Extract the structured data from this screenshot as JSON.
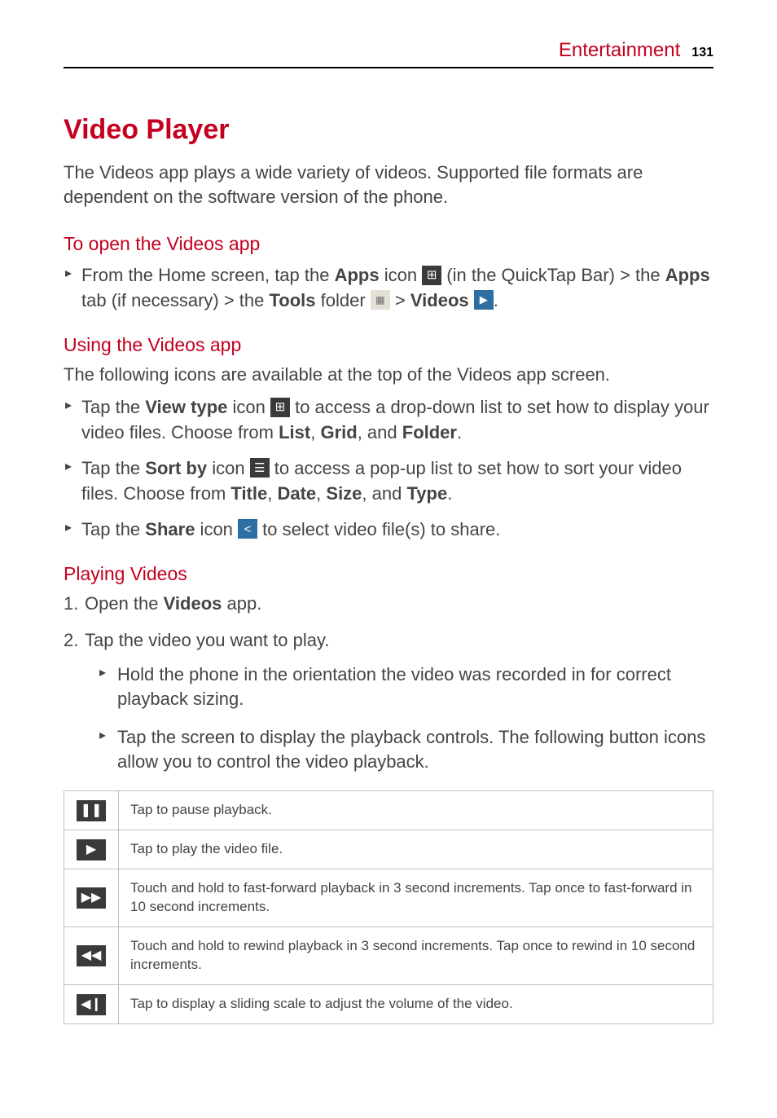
{
  "header": {
    "section": "Entertainment",
    "page_number": "131"
  },
  "title": "Video Player",
  "intro": "The Videos app plays a wide variety of videos. Supported file formats are dependent on the software version of the phone.",
  "open_app": {
    "heading": "To open the Videos app",
    "text_parts": {
      "p1": "From the Home screen, tap the ",
      "apps_label": "Apps",
      "p2": " icon ",
      "p3": " (in the QuickTap Bar) > the ",
      "apps_tab_label": "Apps",
      "p4": " tab (if necessary) > the ",
      "tools_label": "Tools",
      "p5": " folder ",
      "p6": " > ",
      "videos_label": "Videos",
      "p7": " ",
      "p8": "."
    }
  },
  "using_app": {
    "heading": "Using the Videos app",
    "intro": "The following icons are available at the top of the Videos app screen.",
    "items": {
      "view_type": {
        "p1": "Tap the ",
        "label": "View type",
        "p2": " icon ",
        "p3": " to access a drop-down list to set how to display your video files. Choose from ",
        "opt1": "List",
        "sep1": ", ",
        "opt2": "Grid",
        "sep2": ", and ",
        "opt3": "Folder",
        "end": "."
      },
      "sort_by": {
        "p1": "Tap the ",
        "label": "Sort by",
        "p2": " icon ",
        "p3": " to access a pop-up list to set how to sort your video files. Choose from ",
        "opt1": "Title",
        "sep1": ", ",
        "opt2": "Date",
        "sep2": ", ",
        "opt3": "Size",
        "sep3": ", and ",
        "opt4": "Type",
        "end": "."
      },
      "share": {
        "p1": "Tap the ",
        "label": "Share",
        "p2": " icon ",
        "p3": " to select video file(s) to share."
      }
    }
  },
  "playing": {
    "heading": "Playing Videos",
    "step1": {
      "num": "1.",
      "p1": "Open the ",
      "label": "Videos",
      "p2": " app."
    },
    "step2": {
      "num": "2.",
      "text": "Tap the video you want to play.",
      "sub1": "Hold the phone in the orientation the video was recorded in for correct playback sizing.",
      "sub2": "Tap the screen to display the playback controls. The following button icons allow you to control the video playback."
    }
  },
  "table": {
    "rows": [
      {
        "icon": "❚❚",
        "desc": "Tap to pause playback."
      },
      {
        "icon": "▶",
        "desc": "Tap to play the video file."
      },
      {
        "icon": "▶▶",
        "desc": "Touch and hold to fast-forward playback in 3 second increments. Tap once to fast-forward in 10 second increments."
      },
      {
        "icon": "◀◀",
        "desc": "Touch and hold to rewind playback in 3 second increments. Tap once to rewind in 10 second increments."
      },
      {
        "icon": "◀❙",
        "desc": "Tap to display a sliding scale to adjust the volume of the video."
      }
    ]
  },
  "icons": {
    "apps": "⊞",
    "folder": "▦",
    "videos": "▶",
    "view_type": "⊞",
    "sort_by": "☰",
    "share": "<"
  }
}
